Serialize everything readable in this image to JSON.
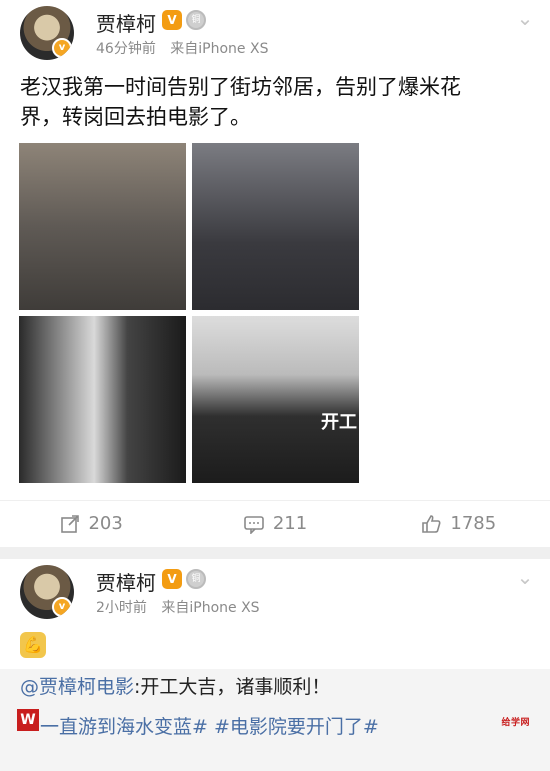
{
  "post1": {
    "author": "贾樟柯",
    "vip_badge": "V",
    "medal": "铜",
    "time": "46分钟前",
    "source": "来自iPhone XS",
    "text_line1": "老汉我第一时间告别了街坊邻居，告别了爆米花",
    "text_line2": "界，转岗回去拍电影了。",
    "image4_caption": "开工",
    "actions": {
      "repost": "203",
      "comment": "211",
      "like": "1785"
    }
  },
  "post2": {
    "author": "贾樟柯",
    "vip_badge": "V",
    "medal": "铜",
    "time": "2小时前",
    "source": "来自iPhone XS",
    "emoji": "💪",
    "quote_mention": "@贾樟柯电影",
    "quote_text": ":开工大吉，诸事顺利！",
    "quote_tags": "一直游到海水变蓝# #电影院要开门了#",
    "watermark": "给学网"
  },
  "icons": {
    "repost": "repost-icon",
    "comment": "comment-icon",
    "like": "like-icon",
    "chevron": "chevron-down-icon"
  }
}
